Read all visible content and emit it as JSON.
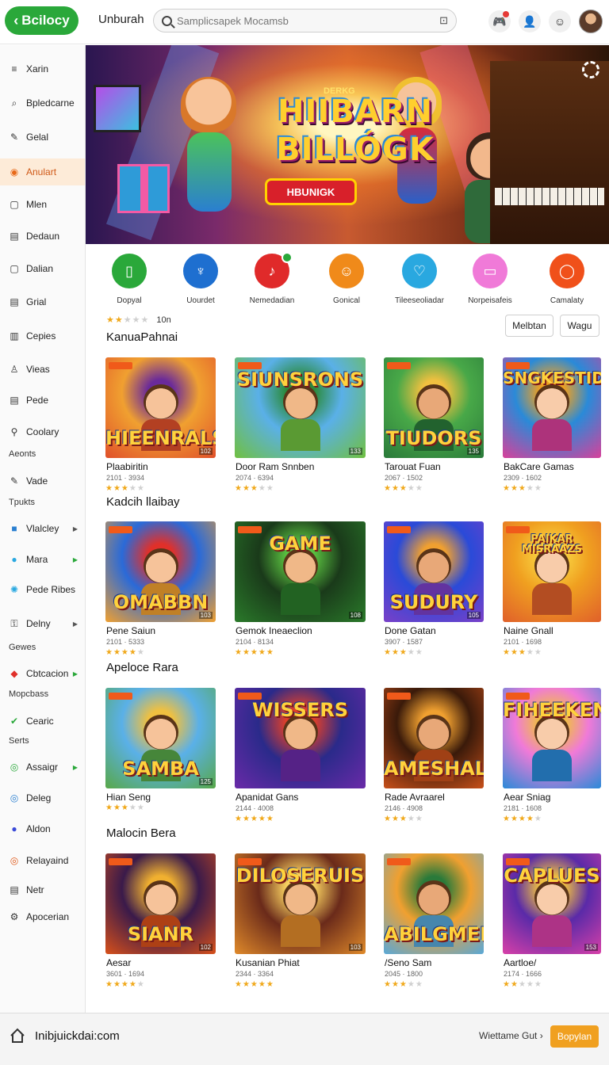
{
  "app": {
    "logo": "Bcilocy",
    "title": "Unburah"
  },
  "search": {
    "placeholder": "Samplicsapek Mocamsb"
  },
  "sidebar": {
    "items": [
      {
        "label": "Xarin",
        "icon": "menu-icon"
      },
      {
        "label": "Bpledcarne",
        "icon": "tag-icon"
      },
      {
        "label": "Gelal",
        "icon": "pencil-icon"
      },
      {
        "label": "Anulart",
        "icon": "fire-icon"
      },
      {
        "label": "Mlen",
        "icon": "square-icon"
      },
      {
        "label": "Dedaun",
        "icon": "document-icon"
      },
      {
        "label": "Dalian",
        "icon": "square-icon"
      },
      {
        "label": "Grial",
        "icon": "document-icon"
      },
      {
        "label": "Cepies",
        "icon": "book-icon"
      },
      {
        "label": "Vieas",
        "icon": "user-icon"
      },
      {
        "label": "Pede",
        "icon": "document-icon"
      },
      {
        "label": "Coolary",
        "icon": "search-icon"
      },
      {
        "label": "Vade",
        "icon": "pencil-icon"
      },
      {
        "label": "Vlalcley",
        "icon": "game-icon"
      },
      {
        "label": "Mara",
        "icon": "circle-icon"
      },
      {
        "label": "Pede Ribes",
        "icon": "gear-icon"
      },
      {
        "label": "Delny",
        "icon": "lock-icon"
      },
      {
        "label": "Cbtcacion",
        "icon": "color-icon"
      },
      {
        "label": "Cearic",
        "icon": "check-icon"
      },
      {
        "label": "Assaigr",
        "icon": "chrome-icon"
      },
      {
        "label": "Deleg",
        "icon": "chrome-icon"
      },
      {
        "label": "Aldon",
        "icon": "circle-icon"
      },
      {
        "label": "Relayaind",
        "icon": "chrome-icon"
      },
      {
        "label": "Netr",
        "icon": "document-icon"
      },
      {
        "label": "Apocerian",
        "icon": "settings-icon"
      }
    ],
    "subs": [
      "Aeonts",
      "Tpukts",
      "Gewes",
      "Mopcbass",
      "Serts"
    ]
  },
  "hero": {
    "small": "DERKG",
    "line1": "HIIBARN",
    "line2": "BILLÓGK",
    "cta": "HBUNIGK"
  },
  "categories": [
    {
      "label": "Dopyal",
      "color": "#2aa83a",
      "icon": "phone-icon"
    },
    {
      "label": "Uourdet",
      "color": "#1e6fd0",
      "icon": "rocket-icon"
    },
    {
      "label": "Nemedadian",
      "color": "#e02a2a",
      "icon": "music-icon"
    },
    {
      "label": "Gonical",
      "color": "#f08a1a",
      "icon": "smile-icon"
    },
    {
      "label": "Tileeseoliadar",
      "color": "#29a8e0",
      "icon": "heart-icon"
    },
    {
      "label": "Norpeisafeis",
      "color": "#f07ad8",
      "icon": "device-icon"
    },
    {
      "label": "Camalaty",
      "color": "#f0501a",
      "icon": "chat-icon"
    }
  ],
  "rating_filter": {
    "label": "10n",
    "stars": 2
  },
  "filters": {
    "primary": "Melbtan",
    "secondary": "Wagu"
  },
  "sections": [
    {
      "title": "KanuaPahnai",
      "cards": [
        {
          "name": "Plaabiritin",
          "meta": "2101 · 3934",
          "stars": 3,
          "art": "HIEENRALS",
          "badge": "102"
        },
        {
          "name": "Door Ram Snnben",
          "meta": "2074 · 6394",
          "stars": 3,
          "art": "SIUNSRONS",
          "badge": "133"
        },
        {
          "name": "Tarouat Fuan",
          "meta": "2067 · 1502",
          "stars": 3,
          "art": "TIUDORS",
          "badge": "135"
        },
        {
          "name": "BakCare Gamas",
          "meta": "2309 · 1602",
          "stars": 3,
          "art": "SNGKESTIDA",
          "badge": ""
        }
      ]
    },
    {
      "title": "Kadcih llaibay",
      "cards": [
        {
          "name": "Pene Saiun",
          "meta": "2101 · 5333",
          "stars": 4,
          "art": "OMABBN",
          "badge": "103"
        },
        {
          "name": "Gemok Ineaeclion",
          "meta": "2104 · 8134",
          "stars": 5,
          "art": "GAME",
          "badge": "108"
        },
        {
          "name": "Done Gatan",
          "meta": "3907 · 1587",
          "stars": 3,
          "art": "SUDURY",
          "badge": "105"
        },
        {
          "name": "Naine Gnall",
          "meta": "2101 · 1698",
          "stars": 3,
          "art": "PAIKAR MISRAAZS",
          "badge": ""
        }
      ]
    },
    {
      "title": "Apeloce Rara",
      "cards": [
        {
          "name": "Hian Seng",
          "meta": "",
          "stars": 3,
          "art": "SAMBA",
          "badge": "125"
        },
        {
          "name": "Apanidat Gans",
          "meta": "2144 · 4008",
          "stars": 5,
          "art": "WISSERS",
          "badge": ""
        },
        {
          "name": "Rade Avraarel",
          "meta": "2146 · 4908",
          "stars": 3,
          "art": "AMESHALS",
          "badge": ""
        },
        {
          "name": "Aear Sniag",
          "meta": "2181 · 1608",
          "stars": 4,
          "art": "FIHEEKEN",
          "badge": ""
        }
      ]
    },
    {
      "title": "Malocin Bera",
      "cards": [
        {
          "name": "Aesar",
          "meta": "3601 · 1694",
          "stars": 4,
          "art": "SIANR",
          "badge": "102"
        },
        {
          "name": "Kusanian Phiat",
          "meta": "2344 · 3364",
          "stars": 5,
          "art": "DILOSERUIS",
          "badge": "103"
        },
        {
          "name": "/Seno Sam",
          "meta": "2045 · 1800",
          "stars": 3,
          "art": "ABILGMER",
          "badge": ""
        },
        {
          "name": "Aartloe/",
          "meta": "2174 · 1666",
          "stars": 2,
          "art": "CAPLUES",
          "badge": "153"
        }
      ]
    }
  ],
  "footer": {
    "url": "Inibjuickdai:com",
    "welcome": "Wiettame Gut ›",
    "button": "Bopylan"
  },
  "colors": {
    "brand": "#2aa83a",
    "accent": "#f0a020",
    "active": "#d05a18"
  }
}
